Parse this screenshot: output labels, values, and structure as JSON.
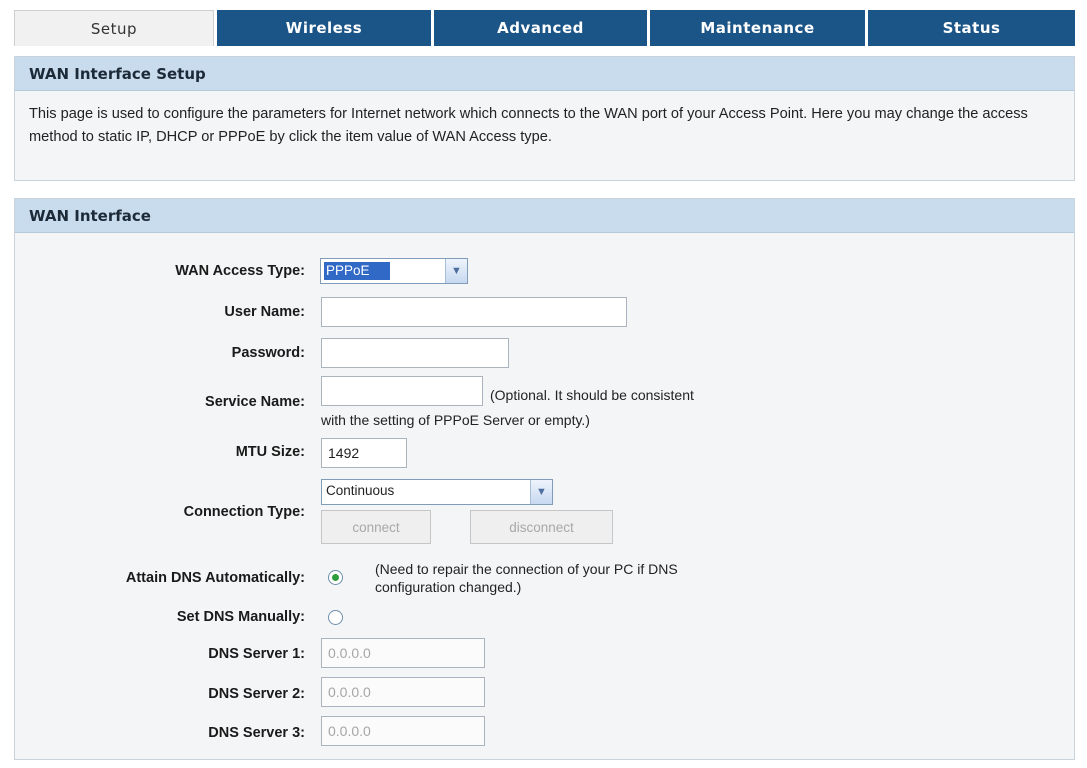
{
  "tabs": [
    "Setup",
    "Wireless",
    "Advanced",
    "Maintenance",
    "Status"
  ],
  "active_tab": "Setup",
  "setup_panel": {
    "title": "WAN Interface Setup",
    "description": "This page is used to configure the parameters for Internet network which connects to the WAN port of your Access Point. Here you may change the access method to static IP, DHCP or PPPoE by click the item value of WAN Access type."
  },
  "wan_panel": {
    "title": "WAN Interface",
    "access_type_label": "WAN Access Type:",
    "access_type_value": "PPPoE",
    "username_label": "User Name:",
    "username_value": "",
    "password_label": "Password:",
    "password_value": "",
    "service_name_label": "Service Name:",
    "service_name_value": "",
    "service_note_1": "(Optional. It should be consistent",
    "service_note_2": "with the setting of PPPoE Server or empty.)",
    "mtu_label": "MTU Size:",
    "mtu_value": "1492",
    "connection_type_label": "Connection Type:",
    "connection_type_value": "Continuous",
    "connect_button": "connect",
    "disconnect_button": "disconnect",
    "dns_auto_label": "Attain DNS Automatically:",
    "dns_auto_note_1": "(Need to repair the connection of your PC if DNS",
    "dns_auto_note_2": "configuration changed.)",
    "dns_manual_label": "Set DNS Manually:",
    "dns1_label": "DNS Server 1:",
    "dns1_value": "0.0.0.0",
    "dns2_label": "DNS Server 2:",
    "dns2_value": "0.0.0.0",
    "dns3_label": "DNS Server 3:",
    "dns3_value": "0.0.0.0",
    "dns_mode_selected": "auto"
  },
  "colors": {
    "tab_bg": "#1b5487",
    "panel_header": "#c8dcee",
    "select_highlight": "#3169c6"
  },
  "icons": {
    "dropdown": "chevron-down-icon"
  }
}
